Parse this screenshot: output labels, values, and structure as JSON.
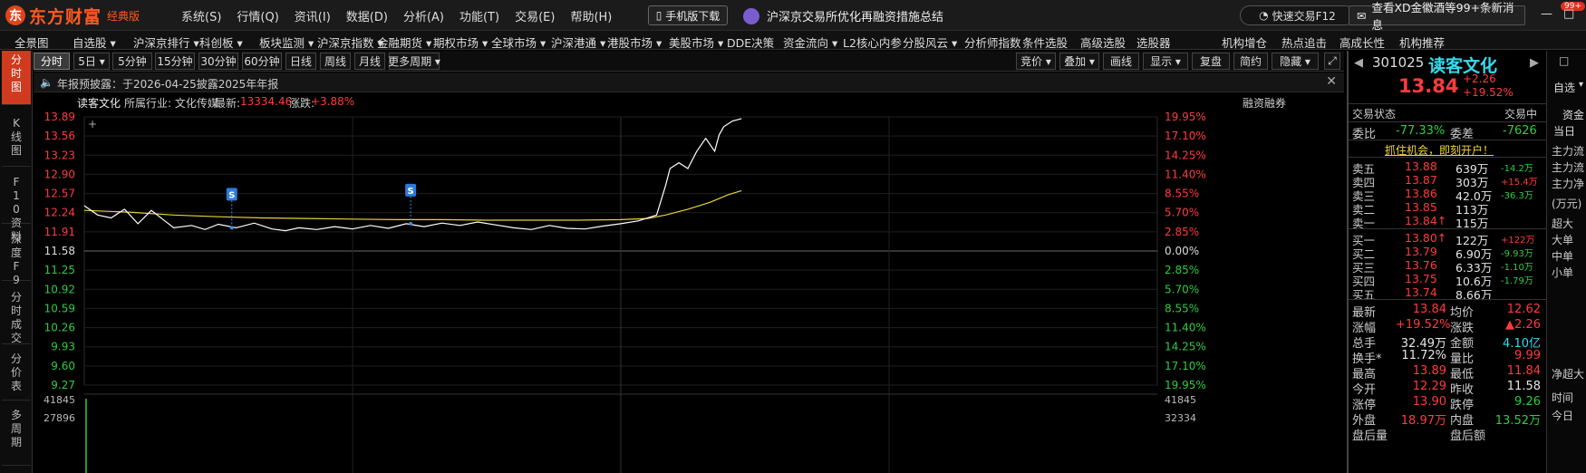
{
  "app": {
    "logo_text": "东方财富",
    "edition": "经典版",
    "menu": [
      "系统(S)",
      "行情(Q)",
      "资讯(I)",
      "数据(D)",
      "分析(A)",
      "功能(T)",
      "交易(E)",
      "帮助(H)"
    ],
    "mobile_download": "手机版下载",
    "news_headline": "沪深京交易所优化再融资措施总结",
    "quick_trade": "快速交易F12",
    "notification": "查看XD金徽酒等99+条新消息",
    "notification_badge": "99+",
    "window_controls": [
      "—",
      "□",
      "✕"
    ]
  },
  "nav": [
    "全景图",
    "自选股 ▾",
    "沪深京排行 ▾",
    "科创板 ▾",
    "板块监测 ▾",
    "沪深京指数 ▾",
    "金融期货 ▾",
    "期权市场 ▾",
    "全球市场 ▾",
    "沪深港通 ▾",
    "港股市场 ▾",
    "美股市场 ▾",
    "DDE决策",
    "资金流向 ▾",
    "L2核心内参",
    "分股风云 ▾",
    "分析师指数",
    "条件选股",
    "高级选股",
    "选股器",
    "机构增仓",
    "热点追击",
    "高成长性",
    "机构推荐"
  ],
  "left_tabs": [
    "分时图",
    "K线图",
    "F10资料",
    "深度F9",
    "分时成交",
    "分价表",
    "多周期"
  ],
  "toolbar": {
    "periods": [
      "分时",
      "5日 ▾",
      "5分钟",
      "15分钟",
      "30分钟",
      "60分钟",
      "日线",
      "周线",
      "月线",
      "更多周期 ▾"
    ],
    "tools": [
      "竞价 ▾",
      "叠加 ▾",
      "画线",
      "显示 ▾",
      "复盘",
      "简约",
      "隐藏 ▾"
    ]
  },
  "info_strip": {
    "text": "年报预披露：于2026-04-25披露2025年年报",
    "close": "✕"
  },
  "stock_line": {
    "name": "读客文化",
    "industry": "所属行业: 文化传媒",
    "latest_label": "最新:",
    "latest_value": "13334.46",
    "change_label": "涨跌:",
    "change_value": "+3.88%",
    "margin_label": "融资融券"
  },
  "chart_data": {
    "type": "line",
    "price_ticks_left": [
      "13.89",
      "13.56",
      "13.23",
      "12.90",
      "12.57",
      "12.24",
      "11.91",
      "11.58",
      "11.25",
      "10.92",
      "10.59",
      "10.26",
      "9.93",
      "9.60",
      "9.27"
    ],
    "pct_ticks_right": [
      "19.95%",
      "17.10%",
      "14.25%",
      "11.40%",
      "8.55%",
      "5.70%",
      "2.85%",
      "0.00%",
      "2.85%",
      "5.70%",
      "8.55%",
      "11.40%",
      "14.25%",
      "17.10%",
      "19.95%"
    ],
    "ylim": [
      9.27,
      13.89
    ],
    "prev_close": 11.58,
    "total_minutes": 240,
    "price_series": {
      "color": "#ffffff",
      "points": [
        [
          0,
          12.36
        ],
        [
          3,
          12.2
        ],
        [
          6,
          12.15
        ],
        [
          9,
          12.3
        ],
        [
          12,
          12.05
        ],
        [
          15,
          12.28
        ],
        [
          18,
          12.1
        ],
        [
          20,
          11.98
        ],
        [
          24,
          12.02
        ],
        [
          27,
          11.95
        ],
        [
          30,
          12.04
        ],
        [
          34,
          11.98
        ],
        [
          38,
          12.06
        ],
        [
          42,
          11.96
        ],
        [
          45,
          11.93
        ],
        [
          48,
          11.98
        ],
        [
          52,
          11.95
        ],
        [
          56,
          12.0
        ],
        [
          60,
          11.96
        ],
        [
          64,
          12.02
        ],
        [
          68,
          11.97
        ],
        [
          72,
          12.05
        ],
        [
          76,
          12.0
        ],
        [
          80,
          12.06
        ],
        [
          84,
          12.02
        ],
        [
          88,
          12.08
        ],
        [
          92,
          12.03
        ],
        [
          96,
          11.98
        ],
        [
          100,
          11.95
        ],
        [
          104,
          12.02
        ],
        [
          108,
          11.97
        ],
        [
          112,
          11.96
        ],
        [
          116,
          12.01
        ],
        [
          120,
          12.05
        ],
        [
          124,
          12.1
        ],
        [
          128,
          12.2
        ],
        [
          130,
          12.7
        ],
        [
          131,
          13.0
        ],
        [
          133,
          13.1
        ],
        [
          135,
          13.0
        ],
        [
          137,
          13.3
        ],
        [
          139,
          13.52
        ],
        [
          141,
          13.3
        ],
        [
          142,
          13.58
        ],
        [
          143,
          13.72
        ],
        [
          145,
          13.82
        ],
        [
          147,
          13.86
        ]
      ]
    },
    "avg_series": {
      "color": "#e6d23a",
      "points": [
        [
          0,
          12.28
        ],
        [
          10,
          12.25
        ],
        [
          20,
          12.2
        ],
        [
          30,
          12.17
        ],
        [
          40,
          12.15
        ],
        [
          50,
          12.14
        ],
        [
          60,
          12.13
        ],
        [
          70,
          12.12
        ],
        [
          80,
          12.12
        ],
        [
          90,
          12.11
        ],
        [
          100,
          12.11
        ],
        [
          110,
          12.11
        ],
        [
          120,
          12.12
        ],
        [
          126,
          12.14
        ],
        [
          130,
          12.2
        ],
        [
          135,
          12.3
        ],
        [
          140,
          12.42
        ],
        [
          144,
          12.55
        ],
        [
          147,
          12.62
        ]
      ]
    },
    "markers": [
      {
        "label": "S",
        "minute": 33
      },
      {
        "label": "S",
        "minute": 73
      }
    ],
    "volume_ticks_left": [
      "41845",
      "27896"
    ],
    "volume_ticks_right": [
      "41845",
      "32334"
    ],
    "grid": true
  },
  "right_panel": {
    "code": "301025",
    "name": "读客文化",
    "price": "13.84",
    "change": "+2.26",
    "change_pct": "+19.52%",
    "side_btns": [
      "自选",
      "▾"
    ],
    "trade_status_label": "交易状态",
    "trade_status_value": "交易中",
    "wb_label": "委比",
    "wb_value": "-77.33%",
    "wc_label": "委差",
    "wc_value": "-7626",
    "promo": "抓住机会，即刻开户！",
    "asks": [
      {
        "label": "卖五",
        "price": "13.88",
        "vol": "639万",
        "delta": "-14.2万"
      },
      {
        "label": "卖四",
        "price": "13.87",
        "vol": "303万",
        "delta": "+15.4万"
      },
      {
        "label": "卖三",
        "price": "13.86",
        "vol": "42.0万",
        "delta": "-36.3万"
      },
      {
        "label": "卖二",
        "price": "13.85",
        "vol": "113万",
        "delta": ""
      },
      {
        "label": "卖一",
        "price": "13.84↑",
        "vol": "115万",
        "delta": ""
      }
    ],
    "bids": [
      {
        "label": "买一",
        "price": "13.80↑",
        "vol": "122万",
        "delta": "+122万"
      },
      {
        "label": "买二",
        "price": "13.79",
        "vol": "6.90万",
        "delta": "-9.93万"
      },
      {
        "label": "买三",
        "price": "13.76",
        "vol": "6.33万",
        "delta": "-1.10万"
      },
      {
        "label": "买四",
        "price": "13.75",
        "vol": "10.6万",
        "delta": "-1.79万"
      },
      {
        "label": "买五",
        "price": "13.74",
        "vol": "8.66万",
        "delta": ""
      }
    ],
    "stats": [
      {
        "l1": "最新",
        "v1": "13.84",
        "l2": "均价",
        "v2": "12.62"
      },
      {
        "l1": "涨幅",
        "v1": "+19.52%",
        "l2": "涨跌",
        "v2": "▲2.26"
      },
      {
        "l1": "总手",
        "v1": "32.49万",
        "l2": "金额",
        "v2": "4.10亿"
      },
      {
        "l1": "换手*",
        "v1": "11.72%",
        "l2": "量比",
        "v2": "9.99"
      },
      {
        "l1": "最高",
        "v1": "13.89",
        "l2": "最低",
        "v2": "11.84"
      },
      {
        "l1": "今开",
        "v1": "12.29",
        "l2": "昨收",
        "v2": "11.58"
      },
      {
        "l1": "涨停",
        "v1": "13.90",
        "l2": "跌停",
        "v2": "9.26"
      },
      {
        "l1": "外盘",
        "v1": "18.97万",
        "l2": "内盘",
        "v2": "13.52万"
      },
      {
        "l1": "盘后量",
        "v1": "",
        "l2": "盘后额",
        "v2": ""
      }
    ],
    "fund_tabs": [
      "资金",
      "当日"
    ],
    "fund_items": [
      "主力流",
      "主力流",
      "主力净",
      "(万元)",
      "超大",
      "大单",
      "中单",
      "小单",
      "净超大",
      "时间",
      "今日"
    ]
  },
  "colors": {
    "up": "#ff3b3b",
    "down": "#2ecc40",
    "accent": "#d03a1e",
    "price_line": "#ffffff",
    "avg_line": "#e6d23a"
  }
}
